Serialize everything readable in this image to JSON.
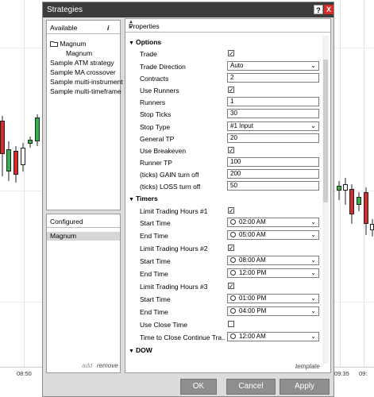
{
  "window": {
    "title": "Strategies",
    "help_label": "?",
    "close_label": "X"
  },
  "available": {
    "header": "Available",
    "info_label": "i",
    "folder": "Magnum",
    "items": [
      "Magnum",
      "Sample ATM strategy",
      "Sample MA crossover",
      "Sample multi-instrument",
      "Sample multi-timeframe"
    ]
  },
  "configured": {
    "header": "Configured",
    "items": [
      "Magnum"
    ],
    "add_label": "add",
    "remove_label": "remove"
  },
  "properties": {
    "header": "Properties",
    "template_label": "template",
    "sections": [
      {
        "name": "Options"
      },
      {
        "name": "Timers"
      },
      {
        "name": "DOW"
      }
    ],
    "options": {
      "trade": {
        "label": "Trade",
        "checked": true
      },
      "trade_direction": {
        "label": "Trade Direction",
        "value": "Auto"
      },
      "contracts": {
        "label": "Contracts",
        "value": "2"
      },
      "use_runners": {
        "label": "Use Runners",
        "checked": true
      },
      "runners": {
        "label": "Runners",
        "value": "1"
      },
      "stop_ticks": {
        "label": "Stop Ticks",
        "value": "30"
      },
      "stop_type": {
        "label": "Stop Type",
        "value": "#1 Input"
      },
      "general_tp": {
        "label": "General TP",
        "value": "20"
      },
      "use_breakeven": {
        "label": "Use Breakeven",
        "checked": true
      },
      "runner_tp": {
        "label": "Runner TP",
        "value": "100"
      },
      "gain_turn_off": {
        "label": "(ticks) GAIN turn off",
        "value": "200"
      },
      "loss_turn_off": {
        "label": "(ticks) LOSS turn off",
        "value": "50"
      }
    },
    "timers": {
      "limit1": {
        "label": "Limit Trading Hours #1",
        "checked": true
      },
      "start1": {
        "label": "Start Time",
        "value": "02:00 AM"
      },
      "end1": {
        "label": "End Time",
        "value": "05:00 AM"
      },
      "limit2": {
        "label": "Limit Trading Hours #2",
        "checked": true
      },
      "start2": {
        "label": "Start Time",
        "value": "08:00 AM"
      },
      "end2": {
        "label": "End Time",
        "value": "12:00 PM"
      },
      "limit3": {
        "label": "Limit Trading Hours #3",
        "checked": true
      },
      "start3": {
        "label": "Start Time",
        "value": "01:00 PM"
      },
      "end3": {
        "label": "End Time",
        "value": "04:00 PM"
      },
      "use_close_time": {
        "label": "Use Close Time",
        "checked": false
      },
      "close_continue": {
        "label": "Time to Close Continue Tra...",
        "value": "12:00 AM"
      }
    }
  },
  "buttons": {
    "ok": "OK",
    "cancel": "Cancel",
    "apply": "Apply"
  },
  "chart": {
    "time_labels": [
      "08:50",
      "09:35",
      "09:"
    ],
    "bullish_color": "#2fb34a",
    "bearish_color": "#d42b2b"
  }
}
